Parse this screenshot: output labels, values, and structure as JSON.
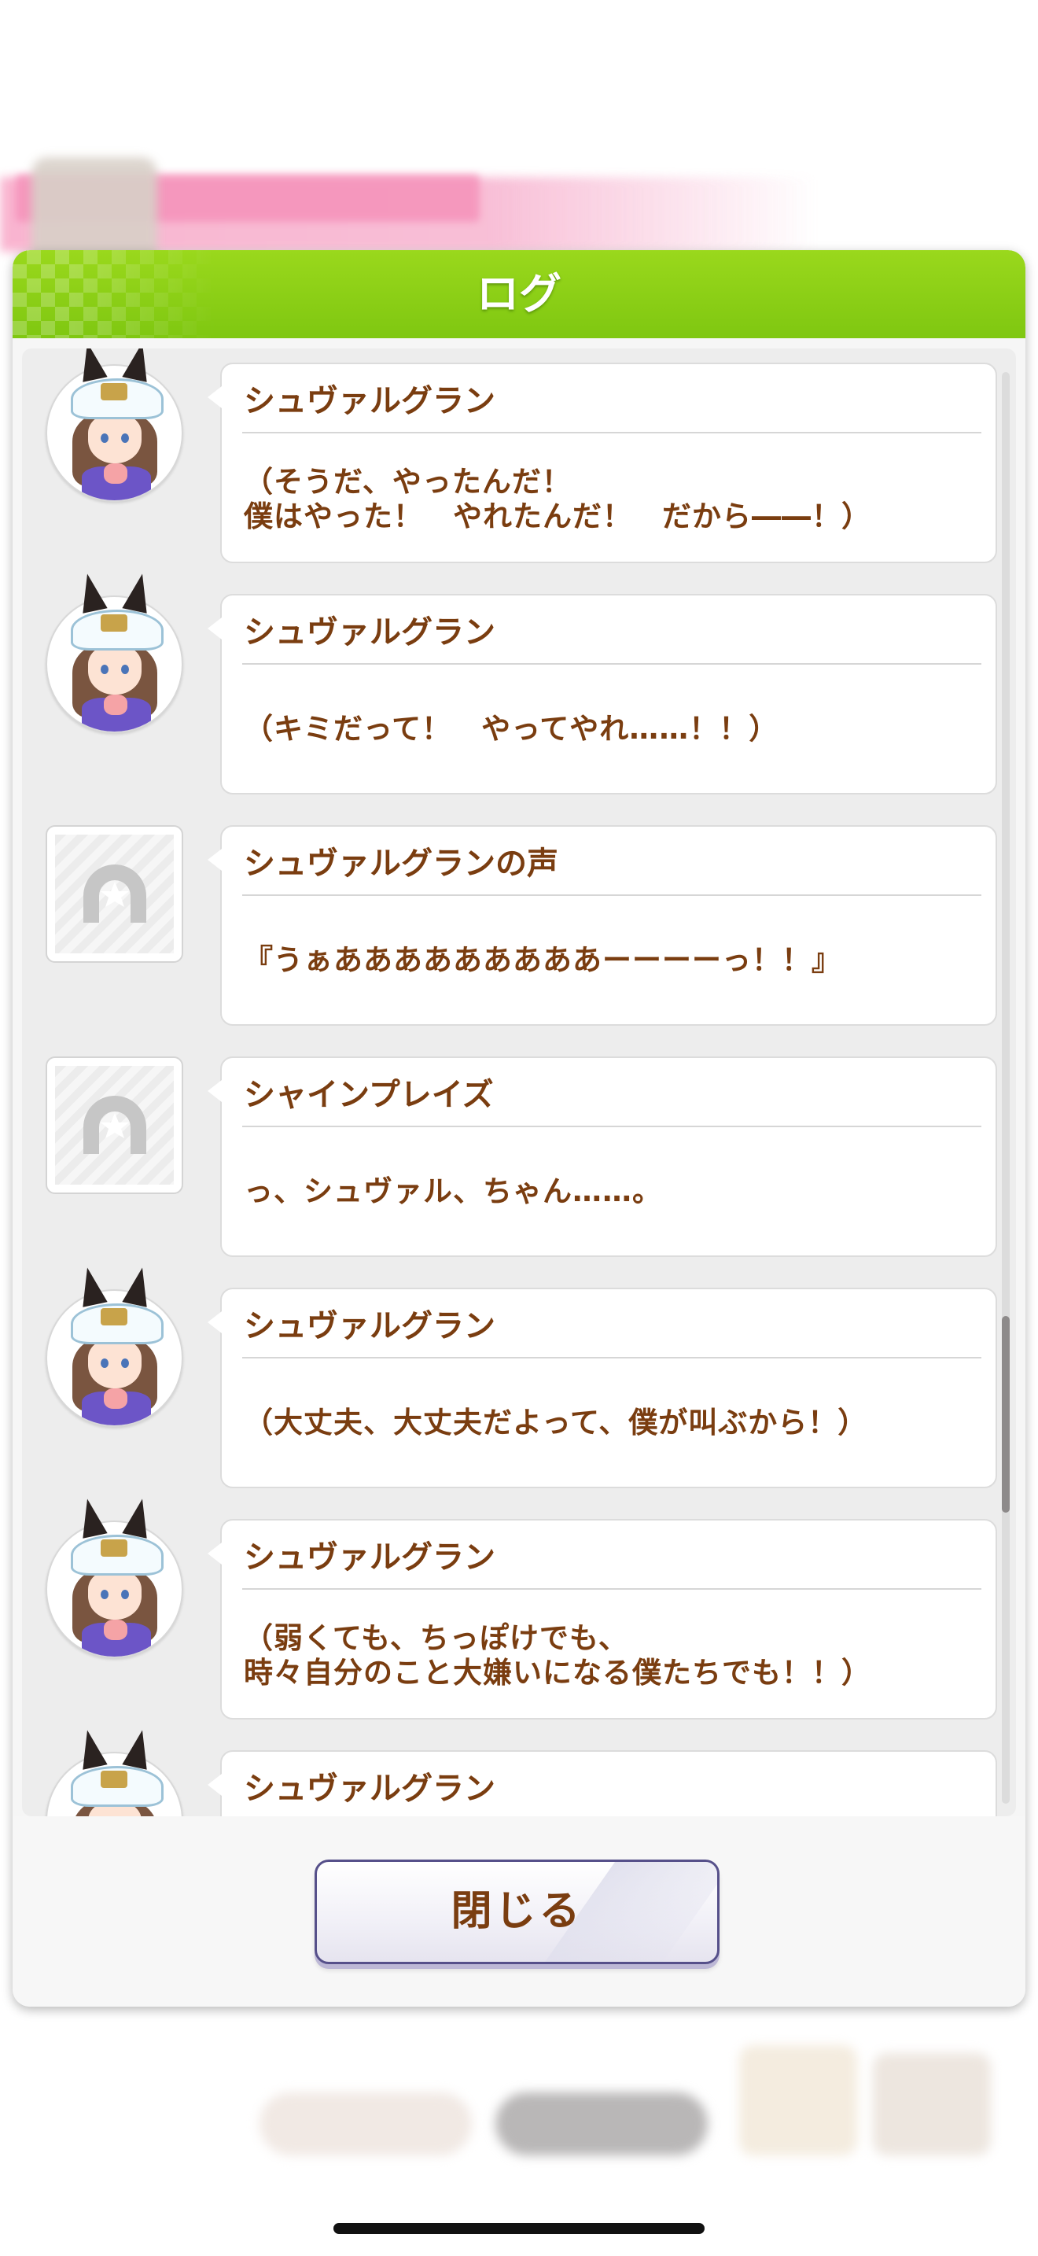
{
  "dialog": {
    "title": "ログ",
    "close_label": "閉じる"
  },
  "log": [
    {
      "speaker": "シュヴァルグラン",
      "text": "（そうだ、やったんだ！\n僕はやった！　やれたんだ！　だから――！）",
      "avatar": "character-avatar"
    },
    {
      "speaker": "シュヴァルグラン",
      "text": "（キミだって！　やってやれ……！！）",
      "avatar": "character-avatar"
    },
    {
      "speaker": "シュヴァルグランの声",
      "text": "『うぁあああああああああーーーーっ！！』",
      "avatar": "horseshoe-placeholder-icon"
    },
    {
      "speaker": "シャインプレイズ",
      "text": "っ、シュヴァル、ちゃん……。",
      "avatar": "horseshoe-placeholder-icon"
    },
    {
      "speaker": "シュヴァルグラン",
      "text": "（大丈夫、大丈夫だよって、僕が叫ぶから！）",
      "avatar": "character-avatar"
    },
    {
      "speaker": "シュヴァルグラン",
      "text": "（弱くても、ちっぽけでも、\n時々自分のこと大嫌いになる僕たちでも！！）",
      "avatar": "character-avatar"
    },
    {
      "speaker": "シュヴァルグラン",
      "text": "",
      "avatar": "character-avatar"
    }
  ],
  "colors": {
    "header_green": "#8fd316",
    "text_brown": "#7a3d10",
    "button_border": "#56508a"
  },
  "scroll": {
    "position": 0.62
  }
}
